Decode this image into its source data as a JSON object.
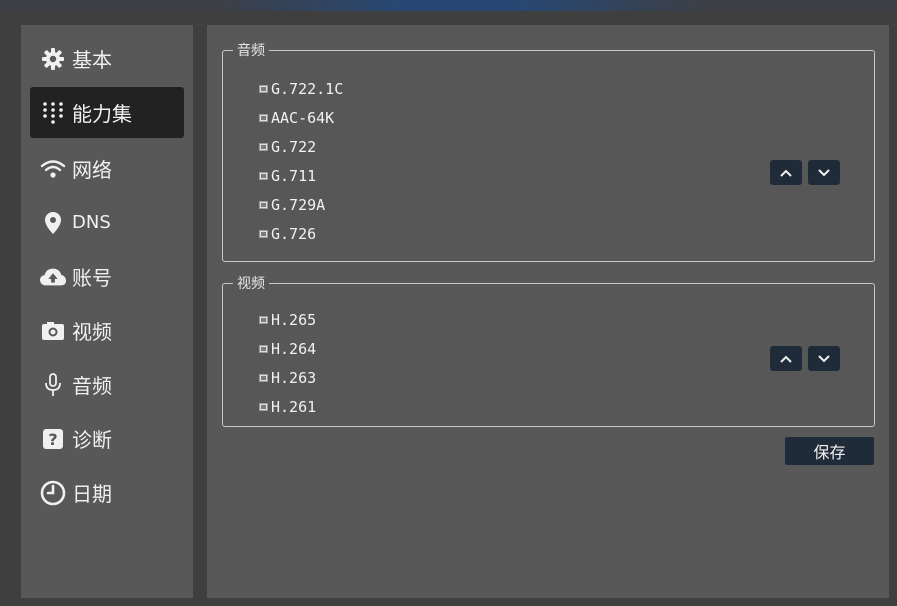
{
  "sidebar": {
    "items": [
      {
        "label": "基本",
        "icon": "gear-icon",
        "active": false
      },
      {
        "label": "能力集",
        "icon": "grid-icon",
        "active": true
      },
      {
        "label": "网络",
        "icon": "wifi-icon",
        "active": false
      },
      {
        "label": "DNS",
        "icon": "location-pin-icon",
        "active": false
      },
      {
        "label": "账号",
        "icon": "cloud-upload-icon",
        "active": false
      },
      {
        "label": "视频",
        "icon": "camera-icon",
        "active": false
      },
      {
        "label": "音频",
        "icon": "microphone-icon",
        "active": false
      },
      {
        "label": "诊断",
        "icon": "question-icon",
        "active": false
      },
      {
        "label": "日期",
        "icon": "clock-icon",
        "active": false
      }
    ]
  },
  "audio": {
    "legend": "音频",
    "codecs": [
      "G.722.1C",
      "AAC-64K",
      "G.722",
      "G.711",
      "G.729A",
      "G.726"
    ]
  },
  "video": {
    "legend": "视频",
    "codecs": [
      "H.265",
      "H.264",
      "H.263",
      "H.261"
    ]
  },
  "actions": {
    "save_label": "保存"
  },
  "colors": {
    "background": "#3f3f3f",
    "panel": "#585858",
    "active_nav": "#222222",
    "button": "#1f2b38",
    "accent": "#234a7e"
  }
}
